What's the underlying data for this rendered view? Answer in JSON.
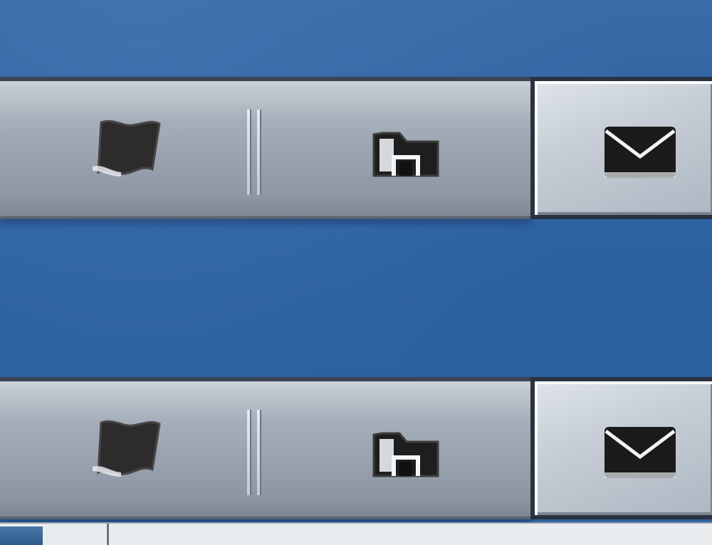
{
  "taskbars": [
    {
      "id": "top",
      "buttons": [
        {
          "name": "windows-start-button",
          "icon": "windows-flag-icon"
        },
        {
          "name": "file-explorer-button",
          "icon": "folder-icon"
        }
      ],
      "tray": {
        "name": "mail-button",
        "icon": "envelope-icon"
      }
    },
    {
      "id": "bottom",
      "buttons": [
        {
          "name": "windows-start-button",
          "icon": "windows-flag-icon"
        },
        {
          "name": "file-explorer-button",
          "icon": "folder-icon"
        }
      ],
      "tray": {
        "name": "mail-button",
        "icon": "envelope-icon"
      }
    }
  ],
  "colors": {
    "desktop": "#2f64a0",
    "bar": "#a0a9b4",
    "icon": "#2b2b2b"
  },
  "bottom_strip": {
    "text": ""
  }
}
